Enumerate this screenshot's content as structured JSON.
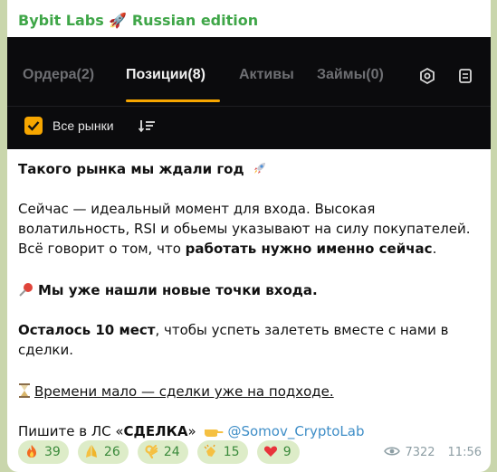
{
  "channel": {
    "title": "Bybit Labs 🚀 Russian edition"
  },
  "screenshot": {
    "tabs": [
      {
        "label": "Ордера(2)",
        "active": false
      },
      {
        "label": "Позиции(8)",
        "active": true
      },
      {
        "label": "Активы",
        "active": false
      },
      {
        "label": "Займы(0)",
        "active": false
      }
    ],
    "filter_label": "Все рынки",
    "filter_checked": true,
    "colors": {
      "background": "#0b0b0d",
      "accent": "#f7a600"
    },
    "icons": [
      "settings-hex-icon",
      "document-icon",
      "checkbox-icon",
      "sort-icon"
    ]
  },
  "message": {
    "line1": "Такого рынка мы ждали год",
    "para2_a": "Сейчас — идеальный момент для входа. Высокая волатильность, RSI и обьемы указывают на силу покупателей. Всё говорит о том, что ",
    "para2_b": "работать нужно именно сейчас",
    "para2_c": ".",
    "line3": "Мы уже нашли новые точки входа.",
    "para4_a": "Осталось 10 мест",
    "para4_b": ", чтобы успеть залететь вместе с нами в сделки.",
    "line5": "Времени мало — сделки уже на подходе.",
    "line6_a": "Пишите в ЛС «",
    "line6_b": "СДЕЛКА",
    "line6_c": "»",
    "line6_link": "@Somov_CryptoLab"
  },
  "reactions": [
    {
      "icon": "fire-icon",
      "count": "39"
    },
    {
      "icon": "pray-icon",
      "count": "26"
    },
    {
      "icon": "ok-hand-icon",
      "count": "24"
    },
    {
      "icon": "clap-icon",
      "count": "15"
    },
    {
      "icon": "heart-icon",
      "count": "9"
    }
  ],
  "meta": {
    "views": "7322",
    "time": "11:56"
  },
  "colors": {
    "link": "#3f8ec7",
    "channel_name": "#3fa648",
    "reaction_bg": "#ddecc8"
  }
}
